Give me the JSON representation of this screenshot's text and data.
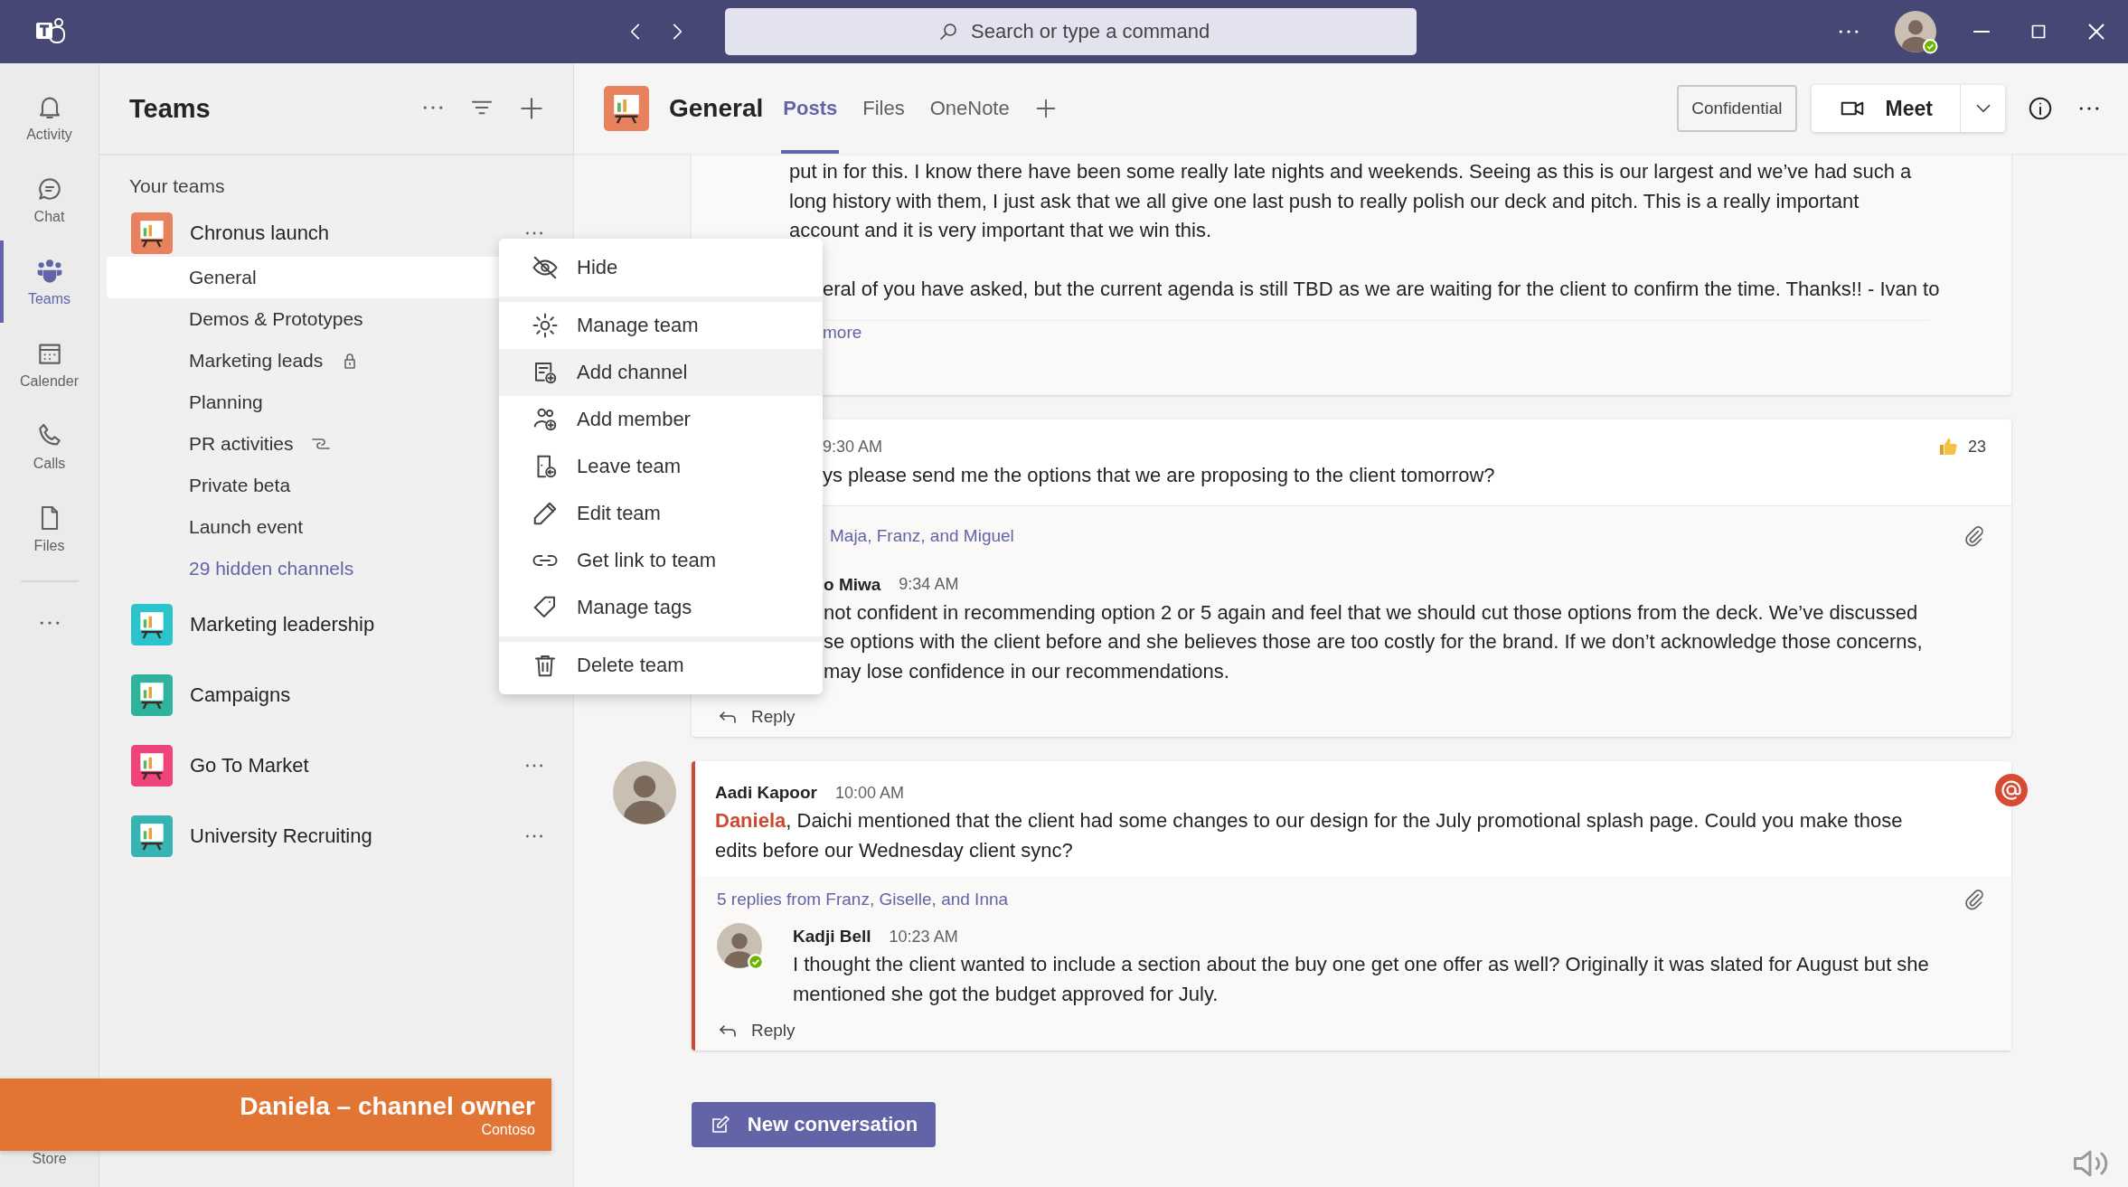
{
  "title_bar": {
    "search": {
      "placeholder": "Search or type a command"
    },
    "profile": {
      "online": true
    }
  },
  "rail": {
    "items": [
      {
        "label": "Activity",
        "selected": false
      },
      {
        "label": "Chat",
        "selected": false
      },
      {
        "label": "Teams",
        "selected": true
      },
      {
        "label": "Calender",
        "selected": false
      },
      {
        "label": "Calls",
        "selected": false
      },
      {
        "label": "Files",
        "selected": false
      }
    ],
    "bottom_item": "Store"
  },
  "teams_panel": {
    "title": "Teams",
    "section": "Your teams",
    "teams": [
      {
        "name": "Chronus launch",
        "color": "#e8825e",
        "menu_button": true,
        "expanded": true,
        "channels": [
          {
            "name": "General",
            "kind": "plain",
            "selected": true
          },
          {
            "name": "Demos & Prototypes",
            "kind": "plain",
            "selected": false
          },
          {
            "name": "Marketing leads",
            "kind": "private",
            "selected": false
          },
          {
            "name": "Planning",
            "kind": "plain",
            "selected": false
          },
          {
            "name": "PR activities",
            "kind": "shared",
            "selected": false
          },
          {
            "name": "Private beta",
            "kind": "plain",
            "selected": false
          },
          {
            "name": "Launch event",
            "kind": "plain",
            "selected": false
          }
        ],
        "hidden_channels": "29 hidden channels"
      },
      {
        "name": "Marketing leadership",
        "color": "#2bc4cd",
        "expanded": false
      },
      {
        "name": "Campaigns",
        "color": "#2fb39c",
        "expanded": false
      },
      {
        "name": "Go To Market",
        "color": "#f0437a",
        "menu_button": true,
        "expanded": false
      },
      {
        "name": "University Recruiting",
        "color": "#36b3b3",
        "menu_button": true,
        "expanded": false
      }
    ]
  },
  "channel_header": {
    "title": "General",
    "tabs": [
      {
        "label": "Posts",
        "selected": true
      },
      {
        "label": "Files",
        "selected": false
      },
      {
        "label": "OneNote",
        "selected": false
      }
    ],
    "sensitivity_label": "Confidential",
    "meet_button": "Meet"
  },
  "context_menu": {
    "items": [
      {
        "label": "Hide",
        "selected": false,
        "divider_before": false
      },
      {
        "label": "Manage team",
        "selected": false,
        "divider_before": true
      },
      {
        "label": "Add channel",
        "selected": true,
        "divider_before": false
      },
      {
        "label": "Add member",
        "selected": false,
        "divider_before": false
      },
      {
        "label": "Leave team",
        "selected": false,
        "divider_before": false
      },
      {
        "label": "Edit team",
        "selected": false,
        "divider_before": false
      },
      {
        "label": "Get link to team",
        "selected": false,
        "divider_before": false
      },
      {
        "label": "Manage tags",
        "selected": false,
        "divider_before": false
      },
      {
        "label": "Delete team",
        "selected": false,
        "divider_before": true
      }
    ]
  },
  "posts": [
    {
      "body": [
        "put in for this. I know there have been some really late nights and weekends. Seeing as this is our largest and we’ve had such a long history with them, I just ask that we all give one last push to really polish our deck and pitch. This is a really important account and it is very important that we win this.",
        "eral of you have asked, but the current agenda is still TBD as we are waiting for the client to confirm the time. Thanks!! - Ivan to"
      ],
      "more_link": "more"
    },
    {
      "time": "9:30 AM",
      "body": "ys please send me the options that we are proposing to the client tomorrow?",
      "reaction_count": "23",
      "replies_link": "Maja, Franz, and Miguel",
      "reply": {
        "author": "o Miwa",
        "time": "9:34 AM",
        "lines": [
          "not confident in recommending option 2 or 5 again and feel that we should cut those options from the deck. We’ve discussed",
          "se options with the client before and she believes those are too costly for the brand. If we don’t acknowledge those concerns,",
          "may lose confidence in our recommendations."
        ]
      },
      "reply_label": "Reply"
    },
    {
      "author": "Aadi Kapoor",
      "time": "10:00 AM",
      "mentioned": true,
      "body": "**Daniela**, Daichi mentioned that the client had some changes to our design for the July promotional splash page. Could you make those edits before our Wednesday client sync?",
      "replies_link": "5 replies from Franz, Giselle, and Inna",
      "reply": {
        "author": "Kadji Bell",
        "time": "10:23 AM",
        "online": true,
        "text": "I thought the client wanted to include a section about the buy one get one offer as well? Originally it was slated for August but she mentioned she got the budget approved for July."
      },
      "reply_label": "Reply"
    }
  ],
  "new_conversation": "New conversation",
  "banner": {
    "title": "Daniela – channel owner",
    "subtitle": "Contoso"
  }
}
